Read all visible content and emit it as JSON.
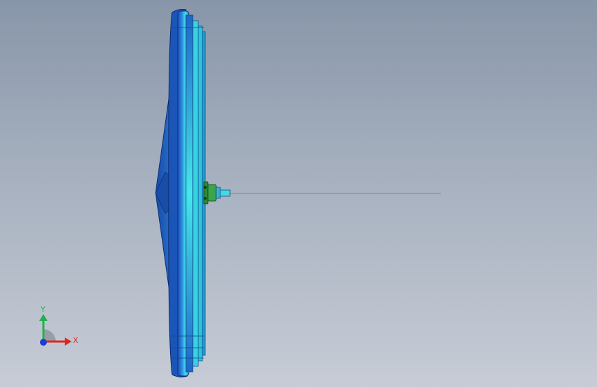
{
  "viewport": {
    "background_top": "#8896a9",
    "background_bottom": "#c7ccd6"
  },
  "model": {
    "colors": {
      "rim_dark": "#1a4fb0",
      "rim_mid": "#2d7fe0",
      "rim_light": "#3fe0e6",
      "hub_green": "#2f8a3a",
      "axis_line": "#22c24a"
    }
  },
  "triad": {
    "x_label": "X",
    "y_label": "Y",
    "x_color": "#e0261e",
    "y_color": "#22b14c",
    "z_color": "#1f3ad6"
  }
}
